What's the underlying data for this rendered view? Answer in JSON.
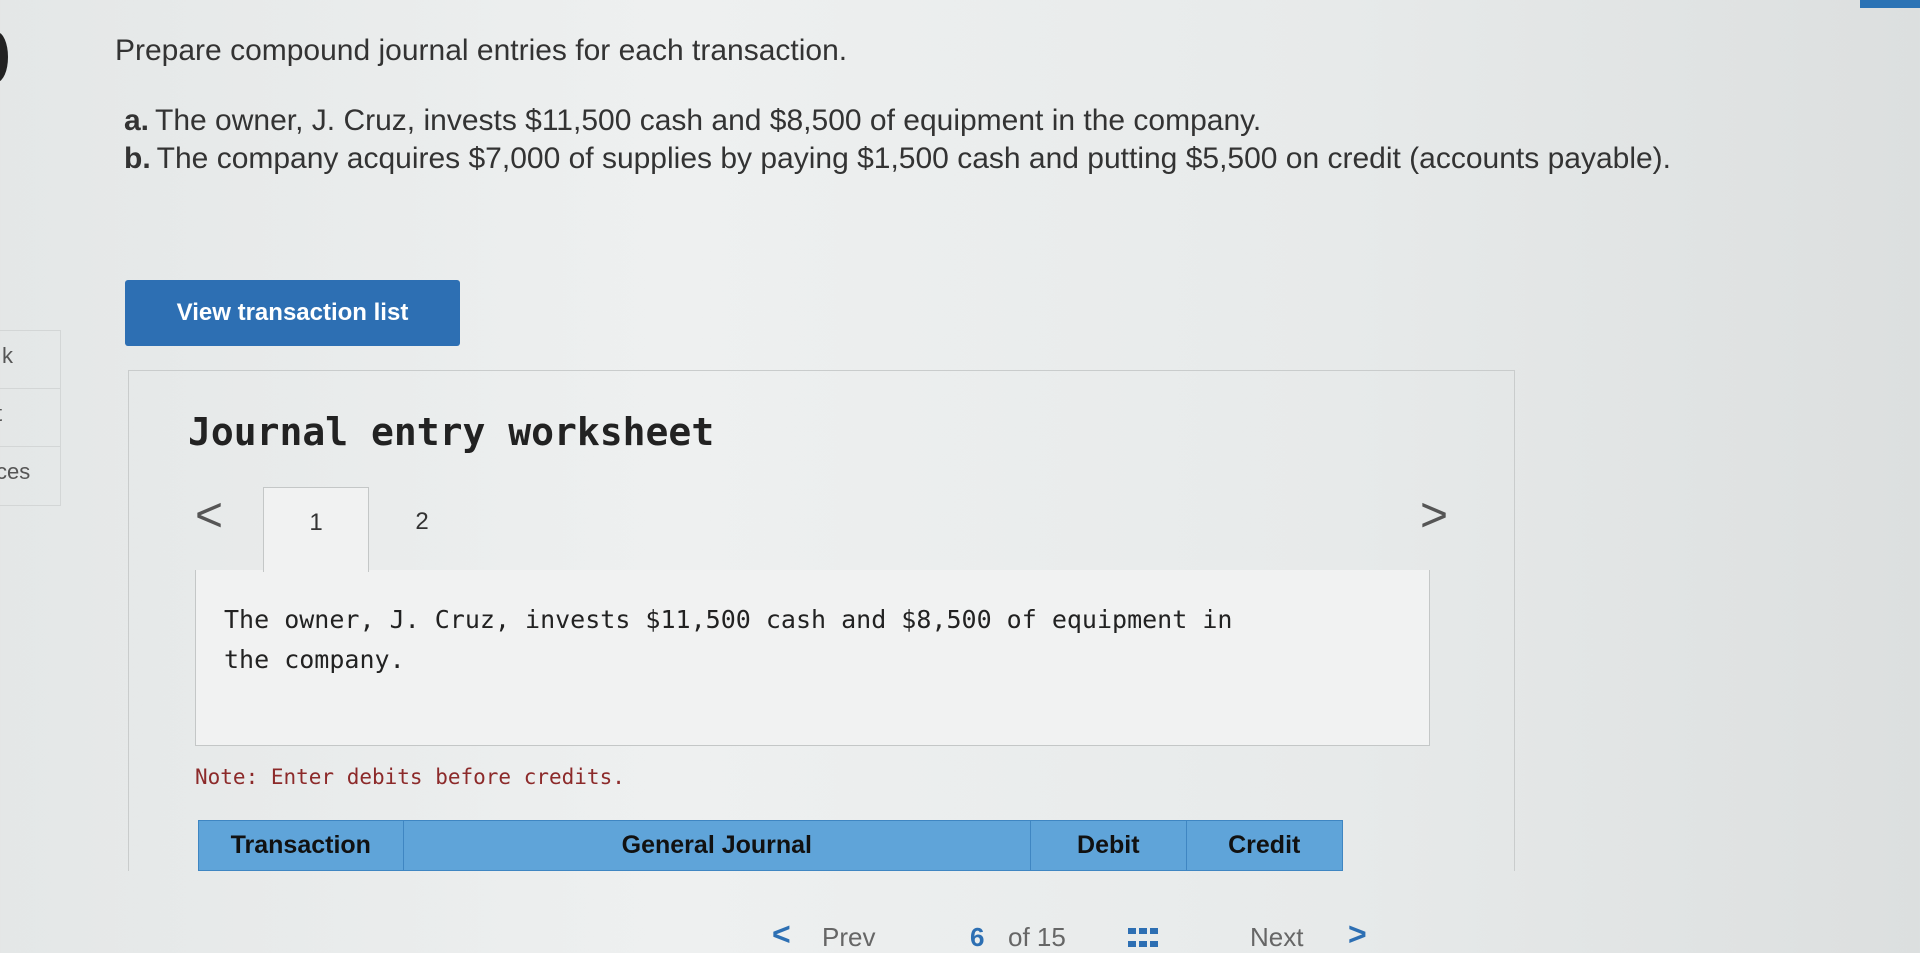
{
  "sidebar": {
    "items": [
      {
        "label": "k"
      },
      {
        "label": "t"
      },
      {
        "label": "ces"
      }
    ]
  },
  "question": {
    "prompt": "Prepare compound journal entries for each transaction.",
    "items": [
      {
        "letter": "a.",
        "text": "The owner, J. Cruz, invests $11,500 cash and $8,500 of equipment in the company."
      },
      {
        "letter": "b.",
        "text": "The company acquires $7,000 of supplies by paying $1,500 cash and putting $5,500 on credit (accounts payable)."
      }
    ]
  },
  "view_transaction_button": "View transaction list",
  "worksheet": {
    "title": "Journal entry worksheet",
    "prev_arrow": "<",
    "next_arrow": ">",
    "tabs": [
      {
        "label": "1",
        "active": true
      },
      {
        "label": "2",
        "active": false
      }
    ],
    "description": "The owner, J. Cruz, invests $11,500 cash and $8,500 of equipment in the company.",
    "note": "Note: Enter debits before credits.",
    "table_headers": [
      "Transaction",
      "General Journal",
      "Debit",
      "Credit"
    ]
  },
  "footer": {
    "prev_arrow": "<",
    "prev_label": "Prev",
    "page_current": "6",
    "page_of": "of 15",
    "next_label": "Next",
    "next_arrow": ">"
  },
  "colors": {
    "accent": "#2d6fb3",
    "table_header": "#5fa4d9",
    "note": "#8c2a2a"
  },
  "icons": [
    "grid-icon",
    "chevron-left-icon",
    "chevron-right-icon"
  ]
}
